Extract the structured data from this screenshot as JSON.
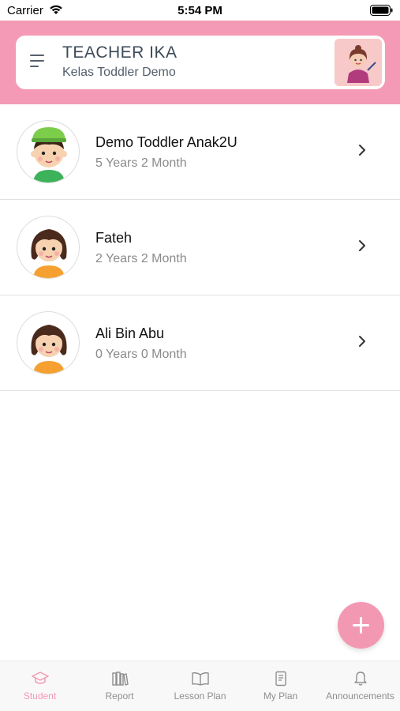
{
  "status_bar": {
    "carrier": "Carrier",
    "time": "5:54 PM"
  },
  "header": {
    "teacher_name": "TEACHER IKA",
    "class_name": "Kelas Toddler Demo",
    "band_color": "#f49ab6"
  },
  "students": [
    {
      "name": "Demo Toddler Anak2U",
      "age": "5 Years 2 Month",
      "avatar": "boy-green-cap-avatar"
    },
    {
      "name": "Fateh",
      "age": "2 Years 2 Month",
      "avatar": "girl-avatar"
    },
    {
      "name": "Ali Bin Abu",
      "age": "0 Years 0 Month",
      "avatar": "girl-avatar"
    }
  ],
  "fab": {
    "icon": "plus-icon",
    "color": "#f398b3"
  },
  "tabs": [
    {
      "label": "Student",
      "icon": "graduation-cap-icon",
      "active": true
    },
    {
      "label": "Report",
      "icon": "books-icon",
      "active": false
    },
    {
      "label": "Lesson Plan",
      "icon": "open-book-icon",
      "active": false
    },
    {
      "label": "My Plan",
      "icon": "notebook-icon",
      "active": false
    },
    {
      "label": "Announcements",
      "icon": "bell-icon",
      "active": false
    }
  ],
  "accent_color": "#f398b3"
}
